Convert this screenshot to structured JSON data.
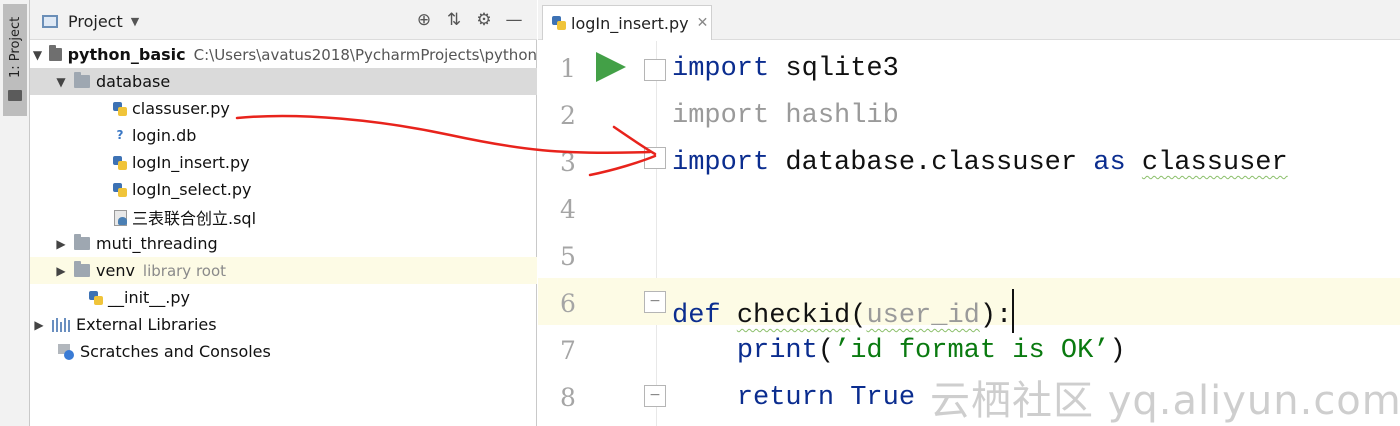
{
  "tool_window": {
    "label": "1: Project",
    "icon": "folder-icon"
  },
  "project_panel": {
    "title": "Project",
    "tools": [
      "target-icon",
      "collapse-icon",
      "gear-icon",
      "minimize-icon"
    ]
  },
  "tree": [
    {
      "label": "python_basic",
      "extra": "C:\\Users\\avatus2018\\PycharmProjects\\python",
      "icon": "folder-icon",
      "expanded": true
    },
    {
      "label": "database",
      "icon": "folder-icon",
      "expanded": true,
      "selected": true
    },
    {
      "label": "classuser.py",
      "icon": "python-file-icon"
    },
    {
      "label": "login.db",
      "icon": "database-file-icon"
    },
    {
      "label": "logIn_insert.py",
      "icon": "python-file-icon"
    },
    {
      "label": "logIn_select.py",
      "icon": "python-file-icon"
    },
    {
      "label": "三表联合创立.sql",
      "icon": "sql-file-icon"
    },
    {
      "label": "muti_threading",
      "icon": "folder-icon",
      "expanded": false
    },
    {
      "label": "venv",
      "extra": "library root",
      "icon": "folder-icon",
      "expanded": false
    },
    {
      "label": "__init__.py",
      "icon": "python-file-icon"
    },
    {
      "label": "External Libraries",
      "icon": "libraries-icon",
      "expanded": false
    },
    {
      "label": "Scratches and Consoles",
      "icon": "scratches-icon"
    }
  ],
  "editor": {
    "tab_label": "logIn_insert.py",
    "line_numbers": [
      "1",
      "2",
      "3",
      "4",
      "5",
      "6",
      "7",
      "8"
    ],
    "lines": {
      "l1_kw": "import",
      "l1_rest": " sqlite3",
      "l2_kw": "import",
      "l2_rest": " hashlib",
      "l3_kw": "import",
      "l3_mod": " database.classuser ",
      "l3_as": "as",
      "l3_alias": "classuser",
      "l6_def": "def",
      "l6_name": "checkid",
      "l6_open": "(",
      "l6_param": "user_id",
      "l6_close": "):",
      "l7_print": "print",
      "l7_open": "(",
      "l7_str": "’id format is OK’",
      "l7_close": ")",
      "l8_return": "return",
      "l8_true": "True"
    }
  },
  "watermark": "云栖社区 yq.aliyun.com",
  "annotation_color": "#e8231c"
}
